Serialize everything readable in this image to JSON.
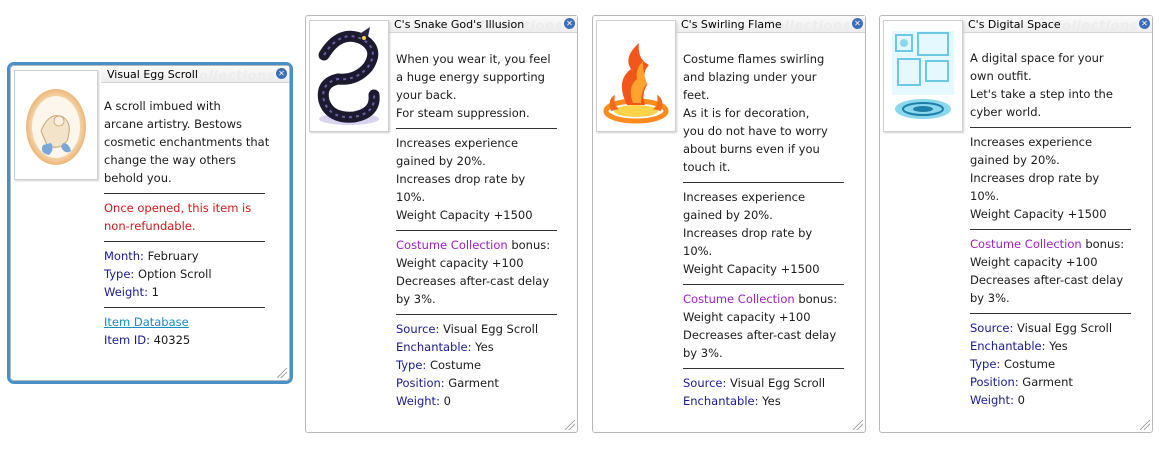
{
  "watermark": "Collections",
  "colors": {
    "accent": "#4a90c8",
    "key": "#1a1a8c",
    "warning": "#cc1a1a",
    "collection": "#9b1fc0",
    "link": "#1a8cc0"
  },
  "card1": {
    "title": "Visual Egg Scroll",
    "desc": [
      "A scroll imbued with",
      "arcane artistry. Bestows",
      "cosmetic enchantments that",
      "change the way others",
      "behold you."
    ],
    "warning": [
      "Once opened, this item is",
      "non-refundable."
    ],
    "month_label": "Month:",
    "month": " February",
    "type_label": "Type:",
    "type": " Option Scroll",
    "weight_label": "Weight:",
    "weight": " 1",
    "db_link": "Item Database",
    "id_label": "Item ID:",
    "id": " 40325"
  },
  "card2": {
    "title": "C's Snake God's Illusion",
    "desc": [
      "When you wear it, you feel",
      "a huge energy supporting",
      "your back.",
      "For steam suppression."
    ],
    "stats": [
      "Increases experience",
      "gained by 20%.",
      "Increases drop rate by",
      "10%.",
      "Weight Capacity +1500"
    ],
    "collection": "Costume Collection",
    "bonus": " bonus:",
    "bonus_lines": [
      "Weight capacity +100",
      "Decreases after-cast delay",
      "by 3%."
    ],
    "source_label": "Source:",
    "source": " Visual Egg Scroll",
    "ench_label": "Enchantable:",
    "ench": " Yes",
    "type_label": "Type:",
    "type": " Costume",
    "pos_label": "Position:",
    "pos": " Garment",
    "weight_label": "Weight:",
    "weight": " 0"
  },
  "card3": {
    "title": "C's Swirling Flame",
    "desc": [
      "Costume flames swirling",
      "and blazing under your",
      "feet.",
      "As it is for decoration,",
      "you do not have to worry",
      "about burns even if you",
      "touch it."
    ],
    "stats": [
      "Increases experience",
      "gained by 20%.",
      "Increases drop rate by",
      "10%.",
      "Weight Capacity +1500"
    ],
    "collection": "Costume Collection",
    "bonus": " bonus:",
    "bonus_lines": [
      "Weight capacity +100",
      "Decreases after-cast delay",
      "by 3%."
    ],
    "source_label": "Source:",
    "source": " Visual Egg Scroll",
    "ench_label": "Enchantable:",
    "ench": " Yes"
  },
  "card4": {
    "title": "C's Digital Space",
    "desc": [
      "A digital space for your",
      "own outfit.",
      "Let's take a step into the",
      "cyber world."
    ],
    "stats": [
      "Increases experience",
      "gained by 20%.",
      "Increases drop rate by",
      "10%.",
      "Weight Capacity +1500"
    ],
    "collection": "Costume Collection",
    "bonus": " bonus:",
    "bonus_lines": [
      "Weight capacity +100",
      "Decreases after-cast delay",
      "by 3%."
    ],
    "source_label": "Source:",
    "source": " Visual Egg Scroll",
    "ench_label": "Enchantable:",
    "ench": " Yes",
    "type_label": "Type:",
    "type": " Costume",
    "pos_label": "Position:",
    "pos": " Garment",
    "weight_label": "Weight:",
    "weight": " 0"
  }
}
